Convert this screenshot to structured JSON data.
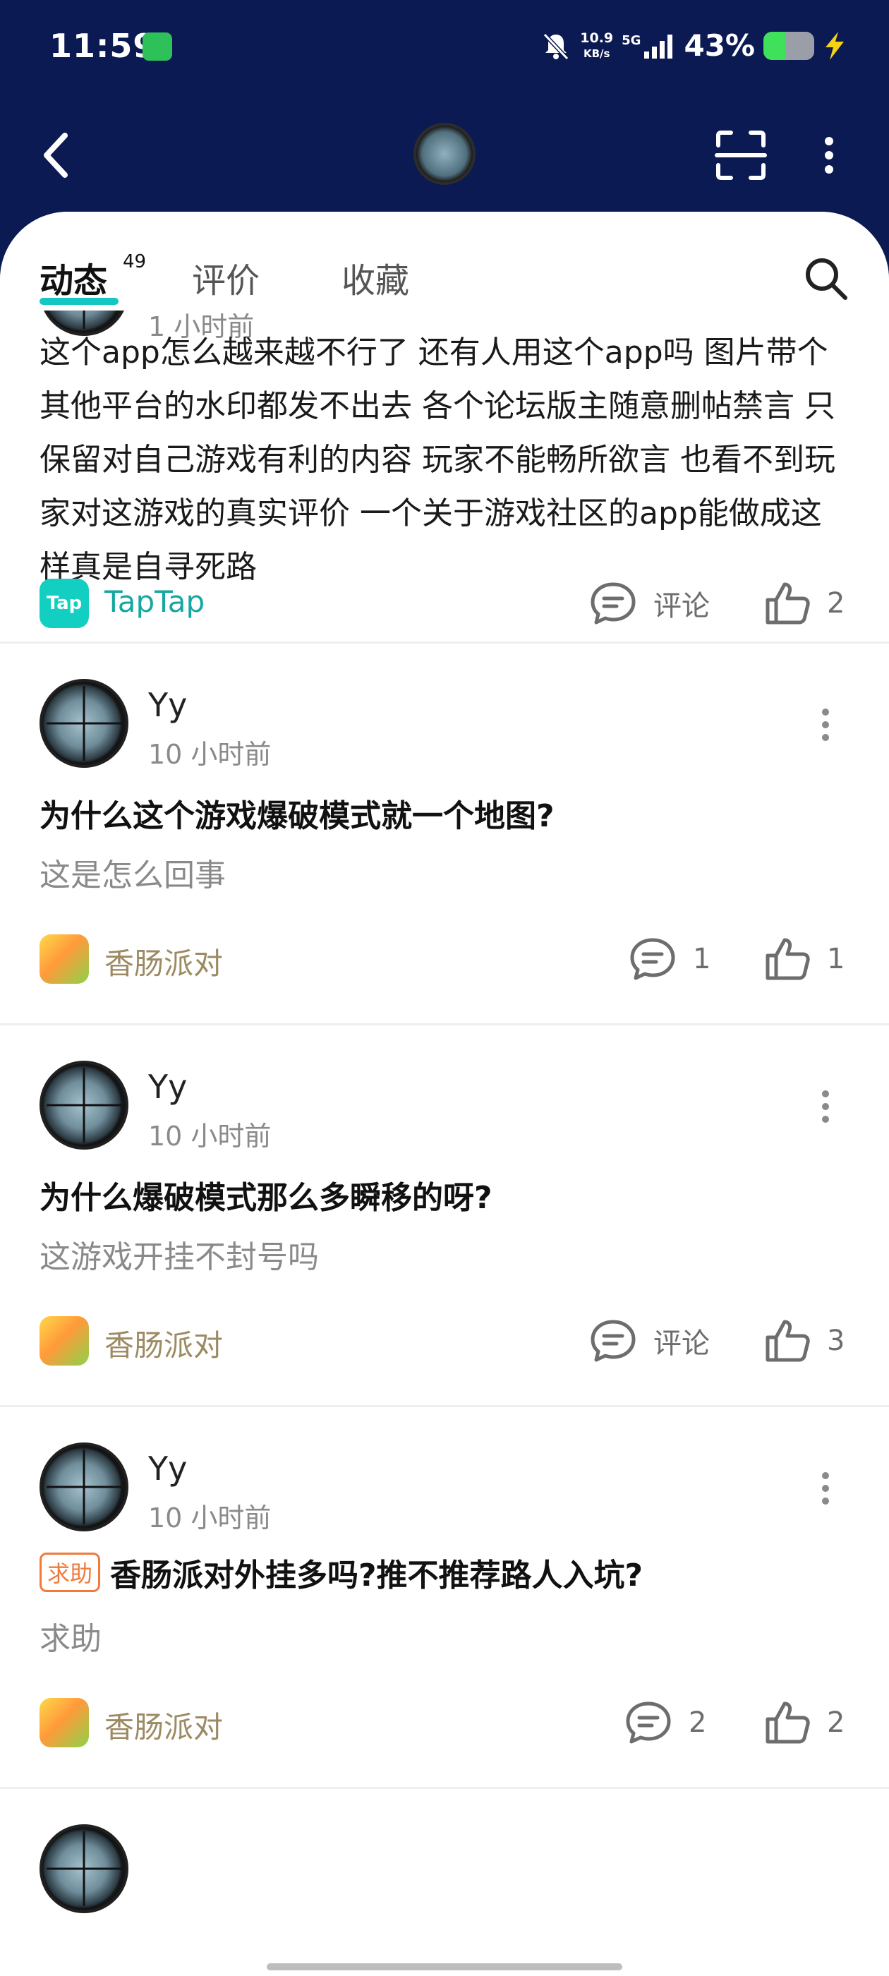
{
  "status_bar": {
    "time": "11:59",
    "net_speed": "10.9",
    "net_speed_unit": "KB/s",
    "network": "5G",
    "battery_percent": "43%",
    "battery_level": 0.43
  },
  "tabs": [
    {
      "label": "动态",
      "count": "49",
      "active": true
    },
    {
      "label": "评价"
    },
    {
      "label": "收藏"
    }
  ],
  "posts": [
    {
      "time": "1 小时前",
      "body": "这个app怎么越来越不行了 还有人用这个app吗 图片带个其他平台的水印都发不出去 各个论坛版主随意删帖禁言 只保留对自己游戏有利的内容 玩家不能畅所欲言 也看不到玩家对这游戏的真实评价 一个关于游戏社区的app能做成这样真是自寻死路",
      "game": "TapTap",
      "game_icon_text": "Tap",
      "comment_label": "评论",
      "likes": "2"
    },
    {
      "author": "Yy",
      "time": "10 小时前",
      "title": "为什么这个游戏爆破模式就一个地图?",
      "subtitle": "这是怎么回事",
      "game": "香肠派对",
      "comments": "1",
      "likes": "1"
    },
    {
      "author": "Yy",
      "time": "10 小时前",
      "title": "为什么爆破模式那么多瞬移的呀?",
      "subtitle": "这游戏开挂不封号吗",
      "game": "香肠派对",
      "comment_label": "评论",
      "likes": "3"
    },
    {
      "author": "Yy",
      "time": "10 小时前",
      "tag": "求助",
      "title": "香肠派对外挂多吗?推不推荐路人入坑?",
      "subtitle": "求助",
      "game": "香肠派对",
      "comments": "2",
      "likes": "2"
    }
  ],
  "icons": {
    "back": "back-arrow-icon",
    "scan": "scan-icon",
    "more": "more-vertical-icon",
    "search": "search-icon",
    "comment": "comment-icon",
    "like": "thumbs-up-icon"
  },
  "colors": {
    "header_bg": "#0b1a52",
    "accent": "#14c7c2",
    "help_tag": "#f07a3a",
    "game_name": "#9c8a62"
  }
}
